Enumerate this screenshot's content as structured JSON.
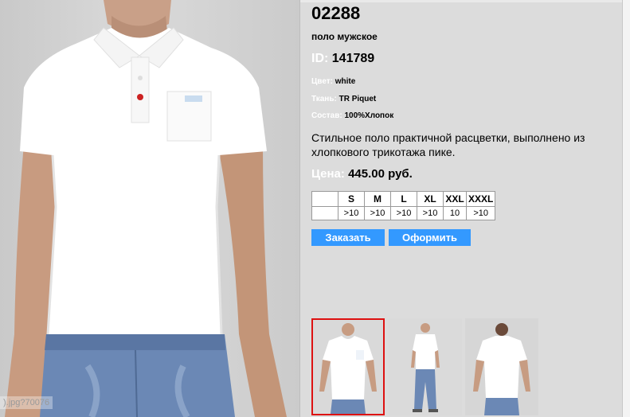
{
  "product": {
    "article": "02288",
    "subtitle": "поло мужское",
    "id_label": "ID:",
    "id_value": "141789",
    "color_label": "Цвет:",
    "color_value": "white",
    "fabric_label": "Ткань:",
    "fabric_value": "TR Piquet",
    "composition_label": "Состав:",
    "composition_value": "100%Хлопок",
    "description": "Стильное поло практичной расцветки, выполнено из хлопкового трикотажа пике.",
    "price_label": "Цена:",
    "price_value": "445.00 руб."
  },
  "sizes": {
    "headers": [
      "",
      "S",
      "M",
      "L",
      "XL",
      "XXL",
      "XXXL"
    ],
    "stock": [
      "",
      ">10",
      ">10",
      ">10",
      ">10",
      "10",
      ">10"
    ]
  },
  "buttons": {
    "order": "Заказать",
    "checkout": "Оформить"
  },
  "photo": {
    "watermark": ").jpg?70076"
  },
  "colors": {
    "button": "#3399ff",
    "background": "#dcdcdc",
    "label_white": "#ffffff",
    "thumb_selected": "#dd1111"
  }
}
